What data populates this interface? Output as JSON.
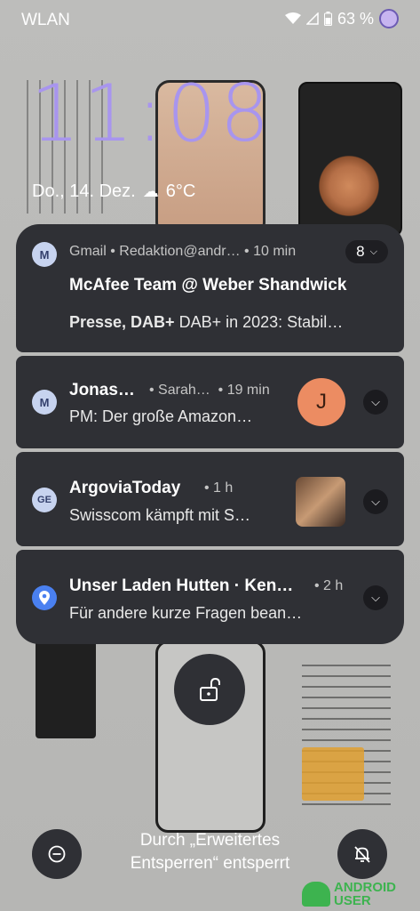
{
  "status_bar": {
    "carrier": "WLAN",
    "battery": "63 %"
  },
  "lockscreen": {
    "time": "11:08",
    "date": "Do., 14. Dez.",
    "weather": "6°C",
    "unlock_hint_line1": "Durch „Erweitertes",
    "unlock_hint_line2": "Entsperren“ entsperrt"
  },
  "notifications": [
    {
      "app": "Gmail",
      "account": "Redaktion@andr…",
      "time": "10 min",
      "count": "8",
      "title": "McAfee Team @ Weber Shandwick",
      "subject": "Presse, DAB+",
      "snippet": "DAB+ in 2023: Stabil…"
    },
    {
      "sender": "Jonas…",
      "recipient": "Sarah…",
      "time": "19 min",
      "body": "PM: Der große Amazon…",
      "avatar_letter": "J"
    },
    {
      "app": "ArgoviaToday",
      "time": "1 h",
      "body": "Swisscom kämpft mit S…"
    },
    {
      "title": "Unser Laden Hutten · Ken…",
      "time": "2 h",
      "body": "Für andere kurze Fragen bean…"
    }
  ],
  "watermark": {
    "line1": "ANDROID",
    "line2": "USER"
  },
  "icons": [
    "wifi-icon",
    "signal-icon",
    "battery-icon",
    "assistant-dot-icon",
    "cloud-icon",
    "gmail-icon",
    "google-news-icon",
    "maps-pin-icon",
    "expand-chevron-icon",
    "unlock-icon",
    "minus-circle-icon",
    "bell-off-icon"
  ]
}
